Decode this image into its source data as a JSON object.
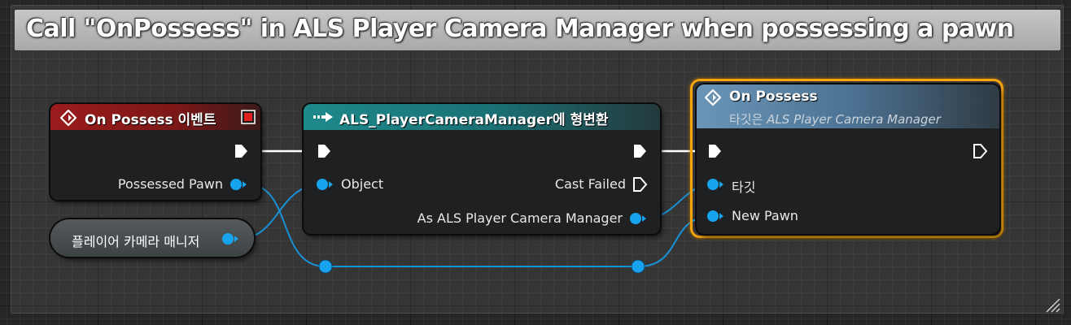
{
  "comment": {
    "title": "Call \"OnPossess\" in ALS Player Camera Manager when possessing a pawn"
  },
  "nodes": {
    "event": {
      "title": "On Possess 이벤트",
      "pins": {
        "possessed_pawn": "Possessed Pawn"
      }
    },
    "variable": {
      "label": "플레이어 카메라 매니저"
    },
    "cast": {
      "title": "ALS_PlayerCameraManager에 형변환",
      "pins": {
        "object": "Object",
        "cast_failed": "Cast Failed",
        "as_output": "As ALS Player Camera Manager"
      }
    },
    "call": {
      "title": "On Possess",
      "subtitle_prefix": "타깃은 ",
      "subtitle_target": "ALS Player Camera Manager",
      "pins": {
        "target": "타깃",
        "new_pawn": "New Pawn"
      }
    }
  },
  "colors": {
    "event_header": "#9b1c1c",
    "cast_header": "#1e8a8c",
    "call_header": "#6a95b7",
    "selection_outline": "#f5a50e",
    "object_pin": "#00a8f3",
    "exec_pin": "#ffffff",
    "comment_bar": "#b8b8b8"
  },
  "icons": {
    "event": "event-diamond-icon",
    "cast": "cast-arrow-icon",
    "call": "function-diamond-icon",
    "delegate": "delegate-square-icon"
  }
}
